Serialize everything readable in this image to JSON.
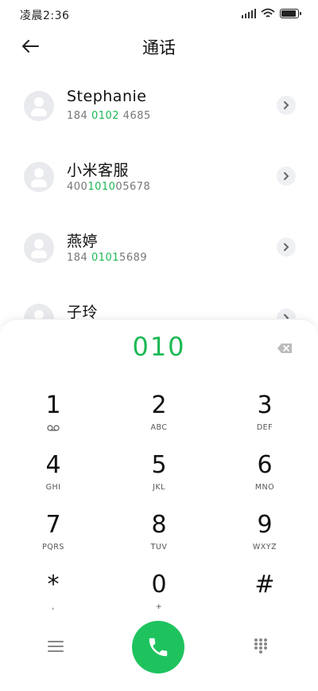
{
  "status_bar": {
    "time": "凌晨2:36",
    "icons": [
      "signal-icon",
      "wifi-icon",
      "battery-icon"
    ]
  },
  "header": {
    "title": "通话",
    "back_icon": "arrow-left-icon"
  },
  "contacts": [
    {
      "name": "Stephanie",
      "number_pre": "184 ",
      "number_match": "0102",
      "number_post": " 4685"
    },
    {
      "name": "小米客服",
      "number_pre": "400",
      "number_match": "1010",
      "number_post": "05678"
    },
    {
      "name": "燕婷",
      "number_pre": "184 ",
      "number_match": "0101",
      "number_post": "5689"
    },
    {
      "name": "子玲",
      "number_pre": "",
      "number_match": "",
      "number_post": ""
    }
  ],
  "dialer": {
    "input": "010",
    "backspace_icon": "backspace-icon",
    "keys": [
      {
        "digit": "1",
        "letters": "",
        "sub_icon": "voicemail-icon"
      },
      {
        "digit": "2",
        "letters": "ABC"
      },
      {
        "digit": "3",
        "letters": "DEF"
      },
      {
        "digit": "4",
        "letters": "GHI"
      },
      {
        "digit": "5",
        "letters": "JKL"
      },
      {
        "digit": "6",
        "letters": "MNO"
      },
      {
        "digit": "7",
        "letters": "PQRS"
      },
      {
        "digit": "8",
        "letters": "TUV"
      },
      {
        "digit": "9",
        "letters": "WXYZ"
      },
      {
        "digit": "*",
        "letters": ","
      },
      {
        "digit": "0",
        "letters": "+"
      },
      {
        "digit": "#",
        "letters": ""
      }
    ]
  },
  "bottom_bar": {
    "menu_icon": "menu-icon",
    "call_icon": "phone-icon",
    "dialpad_icon": "dialpad-icon"
  },
  "colors": {
    "accent": "#1db954",
    "call_button": "#1ec35e",
    "avatar_bg": "#e9eaee"
  }
}
